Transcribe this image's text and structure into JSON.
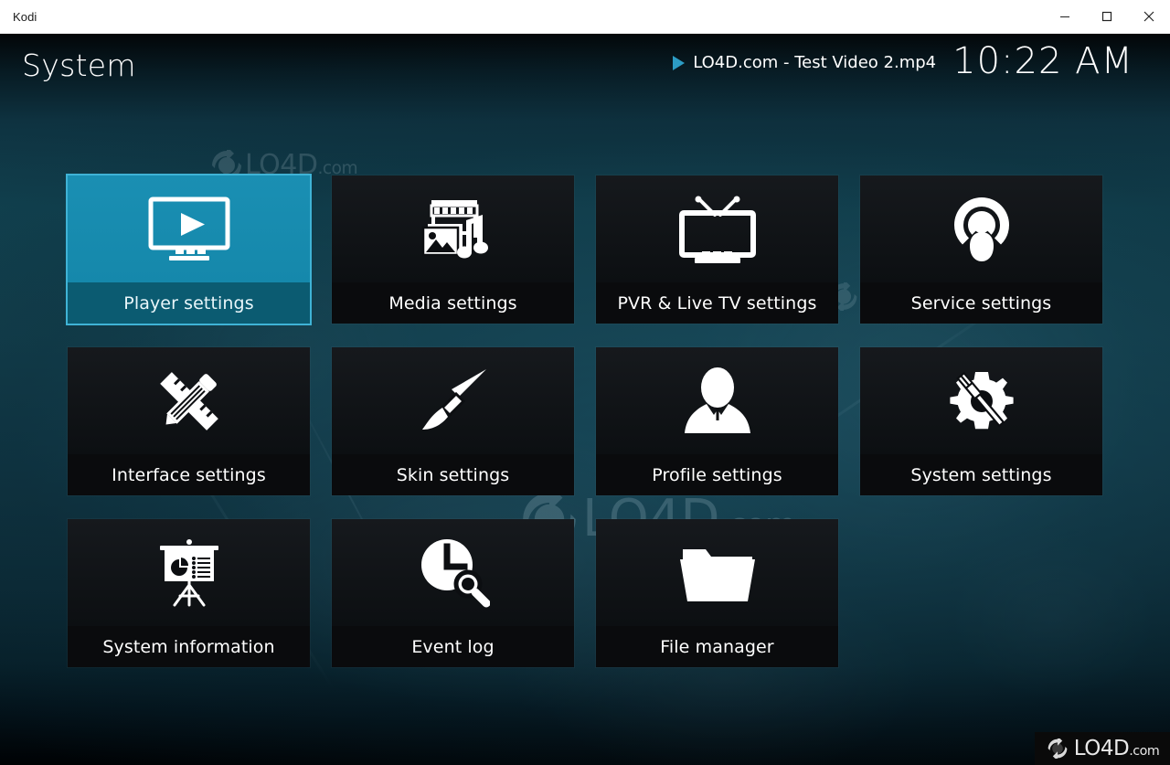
{
  "window": {
    "title": "Kodi",
    "controls": [
      {
        "name": "minimize",
        "label": "Minimize"
      },
      {
        "name": "maximize",
        "label": "Maximize"
      },
      {
        "name": "close",
        "label": "Close"
      }
    ]
  },
  "header": {
    "page_title": "System",
    "now_playing": {
      "icon": "play-icon",
      "title": "LO4D.com - Test Video 2.mp4"
    },
    "clock": "10:22 AM"
  },
  "colors": {
    "accent": "#1588ab",
    "accent_border": "#3fb3d6",
    "selected_label_bg": "#0b5b71",
    "tile_bg": "#0c0e11",
    "play_icon": "#2c9cc4",
    "background_top": "#030608",
    "background_mid": "#11414f"
  },
  "grid": {
    "tiles": [
      {
        "label": "Player settings",
        "icon": "monitor-play-icon",
        "selected": true
      },
      {
        "label": "Media settings",
        "icon": "media-library-icon",
        "selected": false
      },
      {
        "label": "PVR & Live TV settings",
        "icon": "tv-antenna-icon",
        "selected": false
      },
      {
        "label": "Service settings",
        "icon": "broadcast-person-icon",
        "selected": false
      },
      {
        "label": "Interface settings",
        "icon": "ruler-pencil-icon",
        "selected": false
      },
      {
        "label": "Skin settings",
        "icon": "paintbrush-icon",
        "selected": false
      },
      {
        "label": "Profile settings",
        "icon": "person-icon",
        "selected": false
      },
      {
        "label": "System settings",
        "icon": "gear-screwdriver-icon",
        "selected": false
      },
      {
        "label": "System information",
        "icon": "presentation-chart-icon",
        "selected": false
      },
      {
        "label": "Event log",
        "icon": "clock-search-icon",
        "selected": false
      },
      {
        "label": "File manager",
        "icon": "folder-icon",
        "selected": false
      }
    ]
  },
  "watermarks": {
    "small": {
      "text": "LO4D",
      "suffix": ".com"
    },
    "mid": {
      "text": "LO4D",
      "suffix": ".com"
    },
    "big": {
      "text": "LO4D",
      "suffix": ".com"
    },
    "badge": {
      "text": "LO4D",
      "suffix": ".com"
    }
  }
}
